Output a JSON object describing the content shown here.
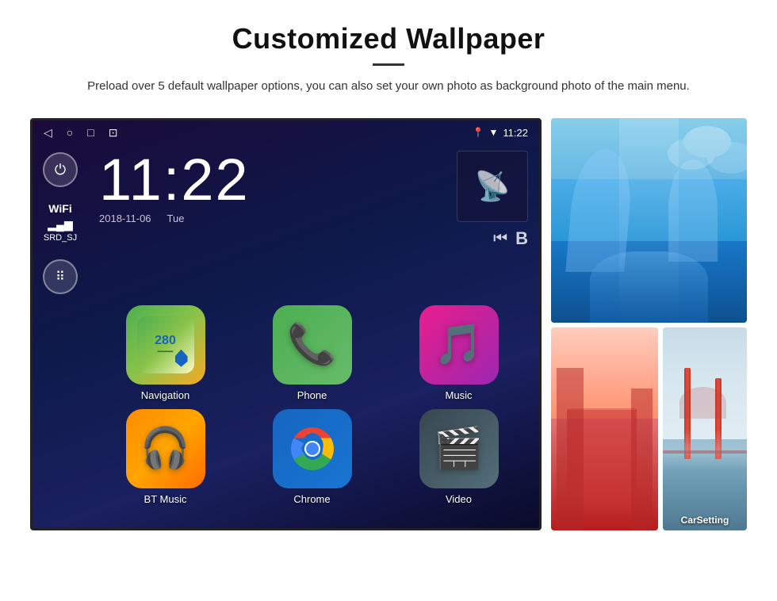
{
  "header": {
    "title": "Customized Wallpaper",
    "description": "Preload over 5 default wallpaper options, you can also set your own photo as background photo of the main menu."
  },
  "statusBar": {
    "time": "11:22",
    "navIcons": [
      "◁",
      "○",
      "□",
      "⊡"
    ],
    "rightIcons": [
      "location",
      "wifi",
      "11:22"
    ]
  },
  "clock": {
    "time": "11:22",
    "date": "2018-11-06",
    "day": "Tue"
  },
  "wifi": {
    "label": "WiFi",
    "network": "SRD_SJ",
    "signal": "▂▄▆"
  },
  "apps": [
    {
      "id": "navigation",
      "label": "Navigation",
      "icon": "🗺"
    },
    {
      "id": "phone",
      "label": "Phone",
      "icon": "📞"
    },
    {
      "id": "music",
      "label": "Music",
      "icon": "🎵"
    },
    {
      "id": "bt-music",
      "label": "BT Music",
      "icon": "🎧"
    },
    {
      "id": "chrome",
      "label": "Chrome",
      "icon": "chrome"
    },
    {
      "id": "video",
      "label": "Video",
      "icon": "🎬"
    }
  ],
  "wallpapers": {
    "topAlt": "Ice cave wallpaper",
    "bottomLeftAlt": "Building wallpaper",
    "bottomRightAlt": "Golden Gate Bridge",
    "carSettingLabel": "CarSetting"
  }
}
